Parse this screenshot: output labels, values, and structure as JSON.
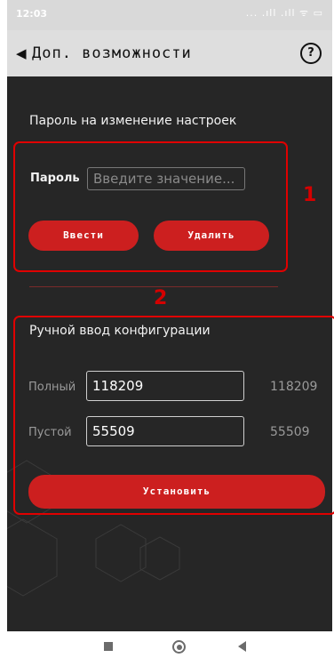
{
  "status_bar": {
    "time": "12:03",
    "indicators": "... .ıll .ıll ᯤ ▭"
  },
  "header": {
    "back_icon": "◀",
    "title": "Доп. возможности",
    "help_label": "?"
  },
  "password_section": {
    "title": "Пароль на изменение настроек",
    "password_label": "Пароль",
    "password_placeholder": "Введите значение...",
    "enter_button": "Ввести",
    "delete_button": "Удалить"
  },
  "manual_config": {
    "title": "Ручной ввод конфигурации",
    "full_label": "Полный",
    "full_value": "118209",
    "full_readout": "118209",
    "empty_label": "Пустой",
    "empty_value": "55509",
    "empty_readout": "55509",
    "set_button": "Установить"
  },
  "annotations": {
    "box1": "1",
    "box2": "2"
  },
  "colors": {
    "accent": "#cc1f1f",
    "background": "#262626",
    "annotation": "#e00000"
  },
  "nav_bar": {
    "icons": [
      "recent-apps-icon",
      "home-icon",
      "back-icon"
    ]
  }
}
